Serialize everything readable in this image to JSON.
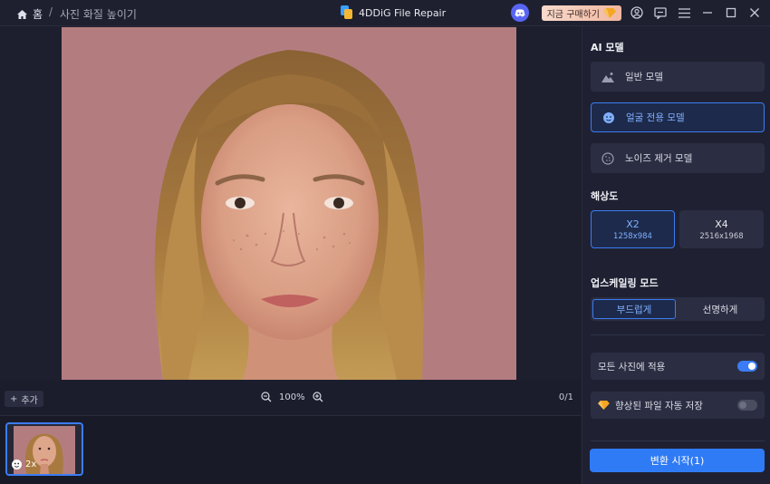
{
  "titlebar": {
    "home_label": "홈",
    "separator": "/",
    "breadcrumb": "사진 화질 높이기",
    "app_name": "4DDiG File Repair",
    "buy_label": "지금 구매하기"
  },
  "workspace": {
    "add_label": "추가",
    "zoom_level": "100%",
    "page_counter": "0/1"
  },
  "thumbnail": {
    "scale_label": "2x"
  },
  "sidebar": {
    "ai_model_title": "AI 모델",
    "models": [
      {
        "label": "일반 모델",
        "icon": "mountain-icon",
        "selected": false
      },
      {
        "label": "얼굴 전용 모델",
        "icon": "face-icon",
        "selected": true
      },
      {
        "label": "노이즈 제거 모델",
        "icon": "noise-icon",
        "selected": false
      }
    ],
    "resolution_title": "해상도",
    "resolutions": [
      {
        "scale": "X2",
        "size": "1258x984",
        "selected": true
      },
      {
        "scale": "X4",
        "size": "2516x1968",
        "selected": false
      }
    ],
    "upscale_title": "업스케일링 모드",
    "upscale_modes": [
      {
        "label": "부드럽게",
        "selected": true
      },
      {
        "label": "선명하게",
        "selected": false
      }
    ],
    "apply_all_label": "모든 사진에 적용",
    "apply_all_on": true,
    "auto_save_label": "향상된 파일 자동 저장",
    "auto_save_on": false,
    "start_label": "변환 시작(1)"
  },
  "colors": {
    "accent": "#3b7cf4",
    "background": "#1b1d2c",
    "panel": "#2b2e42",
    "photo_backdrop": "#b17c7e"
  }
}
